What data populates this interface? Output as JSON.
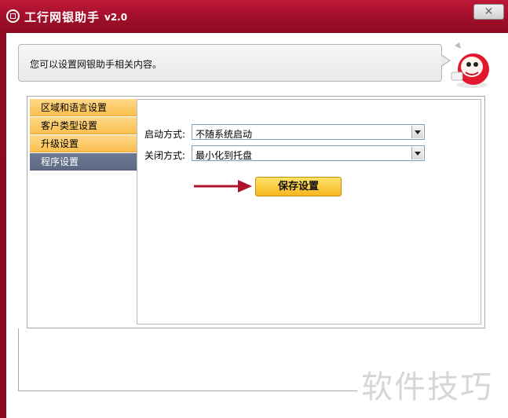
{
  "window": {
    "title": "工行网银助手",
    "version": "v2.0",
    "close_label": "✕",
    "accent_color": "#a00f2a"
  },
  "info": {
    "message": "您可以设置网银助手相关内容。"
  },
  "sidebar": {
    "items": [
      {
        "label": "区域和语言设置",
        "active": false
      },
      {
        "label": "客户类型设置",
        "active": false
      },
      {
        "label": "升级设置",
        "active": false
      },
      {
        "label": "程序设置",
        "active": true
      }
    ]
  },
  "settings": {
    "startup_label": "启动方式:",
    "startup_value": "不随系统启动",
    "close_label": "关闭方式:",
    "close_value": "最小化到托盘",
    "save_label": "保存设置"
  },
  "watermark": {
    "text": "软件技巧"
  },
  "icons": [
    "app-logo-icon",
    "close-icon",
    "mascot-icon",
    "pointer-arrow-icon",
    "chevron-down-icon"
  ]
}
